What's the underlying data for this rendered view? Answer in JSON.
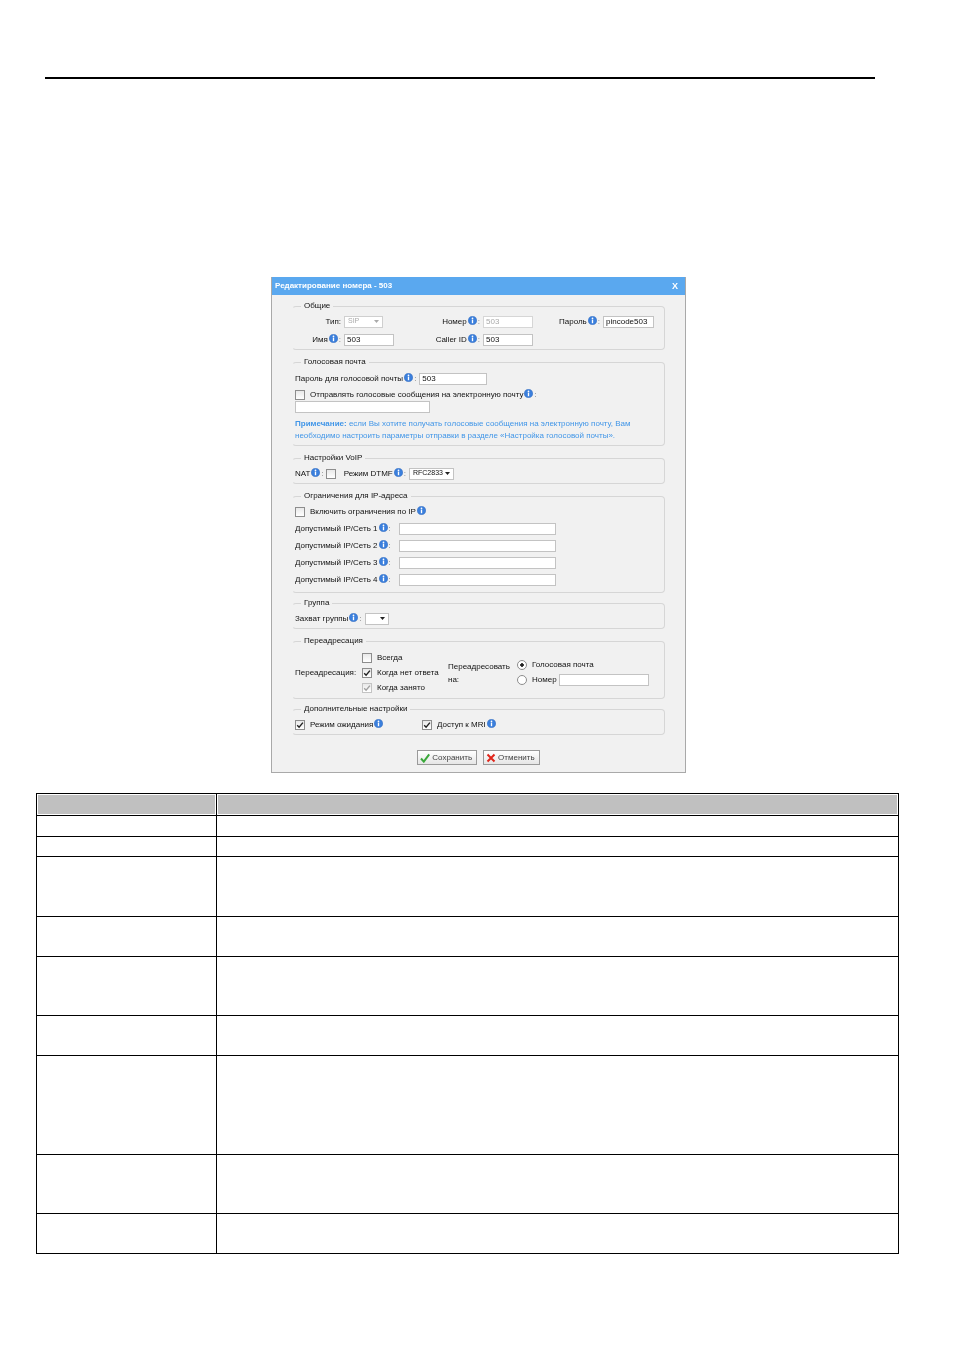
{
  "dialog": {
    "title": "Редактирование номера - 503",
    "close": "X"
  },
  "sections": [
    {
      "kind": "general",
      "legend": "Общие",
      "fields": [
        {
          "kind": "select",
          "label": "Тип:",
          "value": "SIP",
          "disabled": true,
          "info": false
        },
        {
          "kind": "input",
          "label": "Номер",
          "suffix": ":",
          "value": "503",
          "disabled": true,
          "info": true
        },
        {
          "kind": "input",
          "label": "Пароль",
          "suffix": ":",
          "value": "pincode503",
          "disabled": false,
          "info": true
        },
        {
          "kind": "input",
          "label": "Имя",
          "suffix": ":",
          "value": "503",
          "disabled": false,
          "info": true
        },
        {
          "kind": "input",
          "label": "Caller ID",
          "suffix": ":",
          "value": "503",
          "disabled": false,
          "info": true
        }
      ]
    },
    {
      "kind": "voicemail",
      "legend": "Голосовая почта",
      "password": {
        "label": "Пароль для голосовой почты",
        "info": true,
        "suffix": ":",
        "value": "503"
      },
      "send_email": {
        "label": "Отправлять голосовые сообщения на электронную почту",
        "info": true,
        "suffix": ":",
        "checked": false
      },
      "note": "**Примечание:** если Вы хотите получать голосовые сообщения на электронную почту, Вам необходимо настроить параметры отправки в разделе «Настройка голосовой почты»."
    },
    {
      "kind": "voip",
      "legend": "Настройки VoIP",
      "nat": {
        "label": "NAT",
        "info": true,
        "suffix": ":",
        "checked": false
      },
      "dtmf": {
        "label": "Режим DTMF",
        "info": true,
        "suffix": ":",
        "value": "RFC2833"
      }
    },
    {
      "kind": "ip",
      "legend": "Ограничения для IP-адреса",
      "enable": {
        "label": "Включить ограничения по IP",
        "info": true,
        "checked": false
      },
      "networks": [
        {
          "label": "Допустимый IP/Сеть 1",
          "info": true,
          "suffix": ":"
        },
        {
          "label": "Допустимый IP/Сеть 2",
          "info": true,
          "suffix": ":"
        },
        {
          "label": "Допустимый IP/Сеть 3",
          "info": true,
          "suffix": ":"
        },
        {
          "label": "Допустимый IP/Сеть 4",
          "info": true,
          "suffix": ":"
        }
      ]
    },
    {
      "kind": "group",
      "legend": "Группа",
      "pickup": {
        "label": "Захват группы",
        "info": true,
        "suffix": ":"
      }
    },
    {
      "kind": "forwarding",
      "legend": "Переадресация",
      "label": "Переадресация:",
      "conditions": [
        {
          "label": "Всегда",
          "checked": false,
          "disabled": false
        },
        {
          "label": "Когда нет ответа",
          "checked": true,
          "disabled": false
        },
        {
          "label": "Когда занято",
          "checked": true,
          "disabled": true
        }
      ],
      "target_label": "Переадресовать на:",
      "targets": [
        {
          "kind": "plain",
          "label": "Голосовая почта",
          "selected": true
        },
        {
          "kind": "input",
          "label": "Номер",
          "selected": false
        }
      ]
    },
    {
      "kind": "advanced",
      "legend": "Дополнительные настройки",
      "options": [
        {
          "label": "Режим ожидания",
          "info": true,
          "checked": true
        },
        {
          "label": "Доступ к MRI",
          "info": true,
          "checked": true
        }
      ]
    }
  ],
  "buttons": [
    {
      "kind": "save",
      "label": "Сохранить"
    },
    {
      "kind": "cancel",
      "label": "Отменить"
    }
  ]
}
